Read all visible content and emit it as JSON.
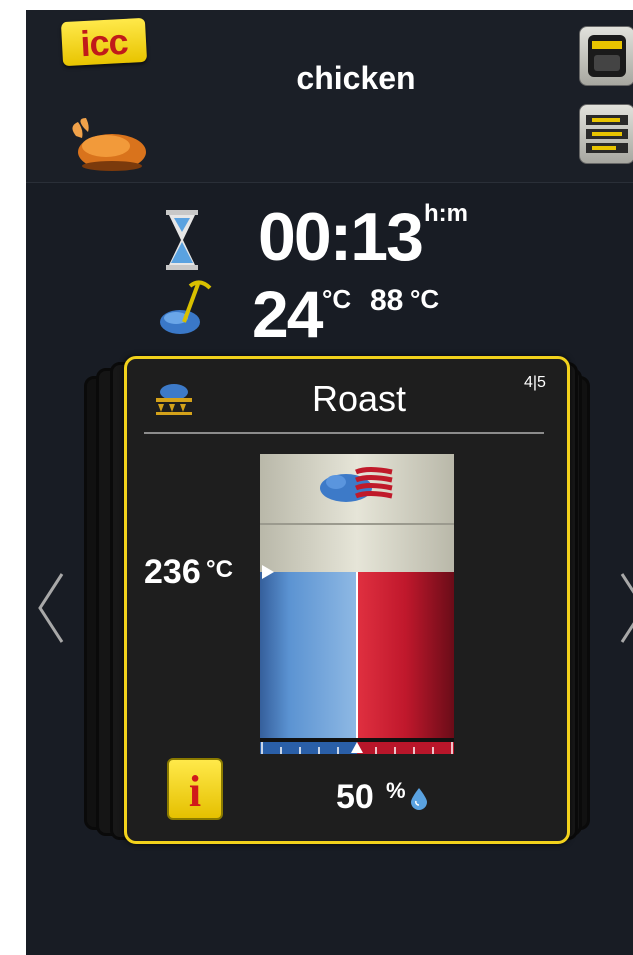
{
  "header": {
    "logo_text": "icc",
    "title": "chicken"
  },
  "status": {
    "time_remaining": "00:13",
    "time_unit": "h:m",
    "core_temperature": "24",
    "core_temperature_unit": "°C",
    "core_target": "88",
    "core_target_unit": "°C"
  },
  "step": {
    "name": "Roast",
    "counter": "4|5",
    "set_temperature": "236",
    "set_temperature_unit": "°C",
    "humidity": "50",
    "humidity_unit": "%",
    "humidity_fraction": 0.5
  },
  "icons": {
    "logo": "icc-logo",
    "food": "chicken-icon",
    "timer": "hourglass-icon",
    "probe": "core-probe-icon",
    "step": "roast-icon",
    "climate": "steam-heat-icon",
    "drop": "water-drop-icon",
    "info": "info-icon",
    "prev": "chevron-left-icon",
    "next": "chevron-right-icon",
    "display": "display-icon",
    "list": "list-icon"
  },
  "colors": {
    "accent_yellow": "#f2d21c",
    "steam_blue": "#4e86c6",
    "heat_red": "#c0182c",
    "background": "#181c24"
  }
}
